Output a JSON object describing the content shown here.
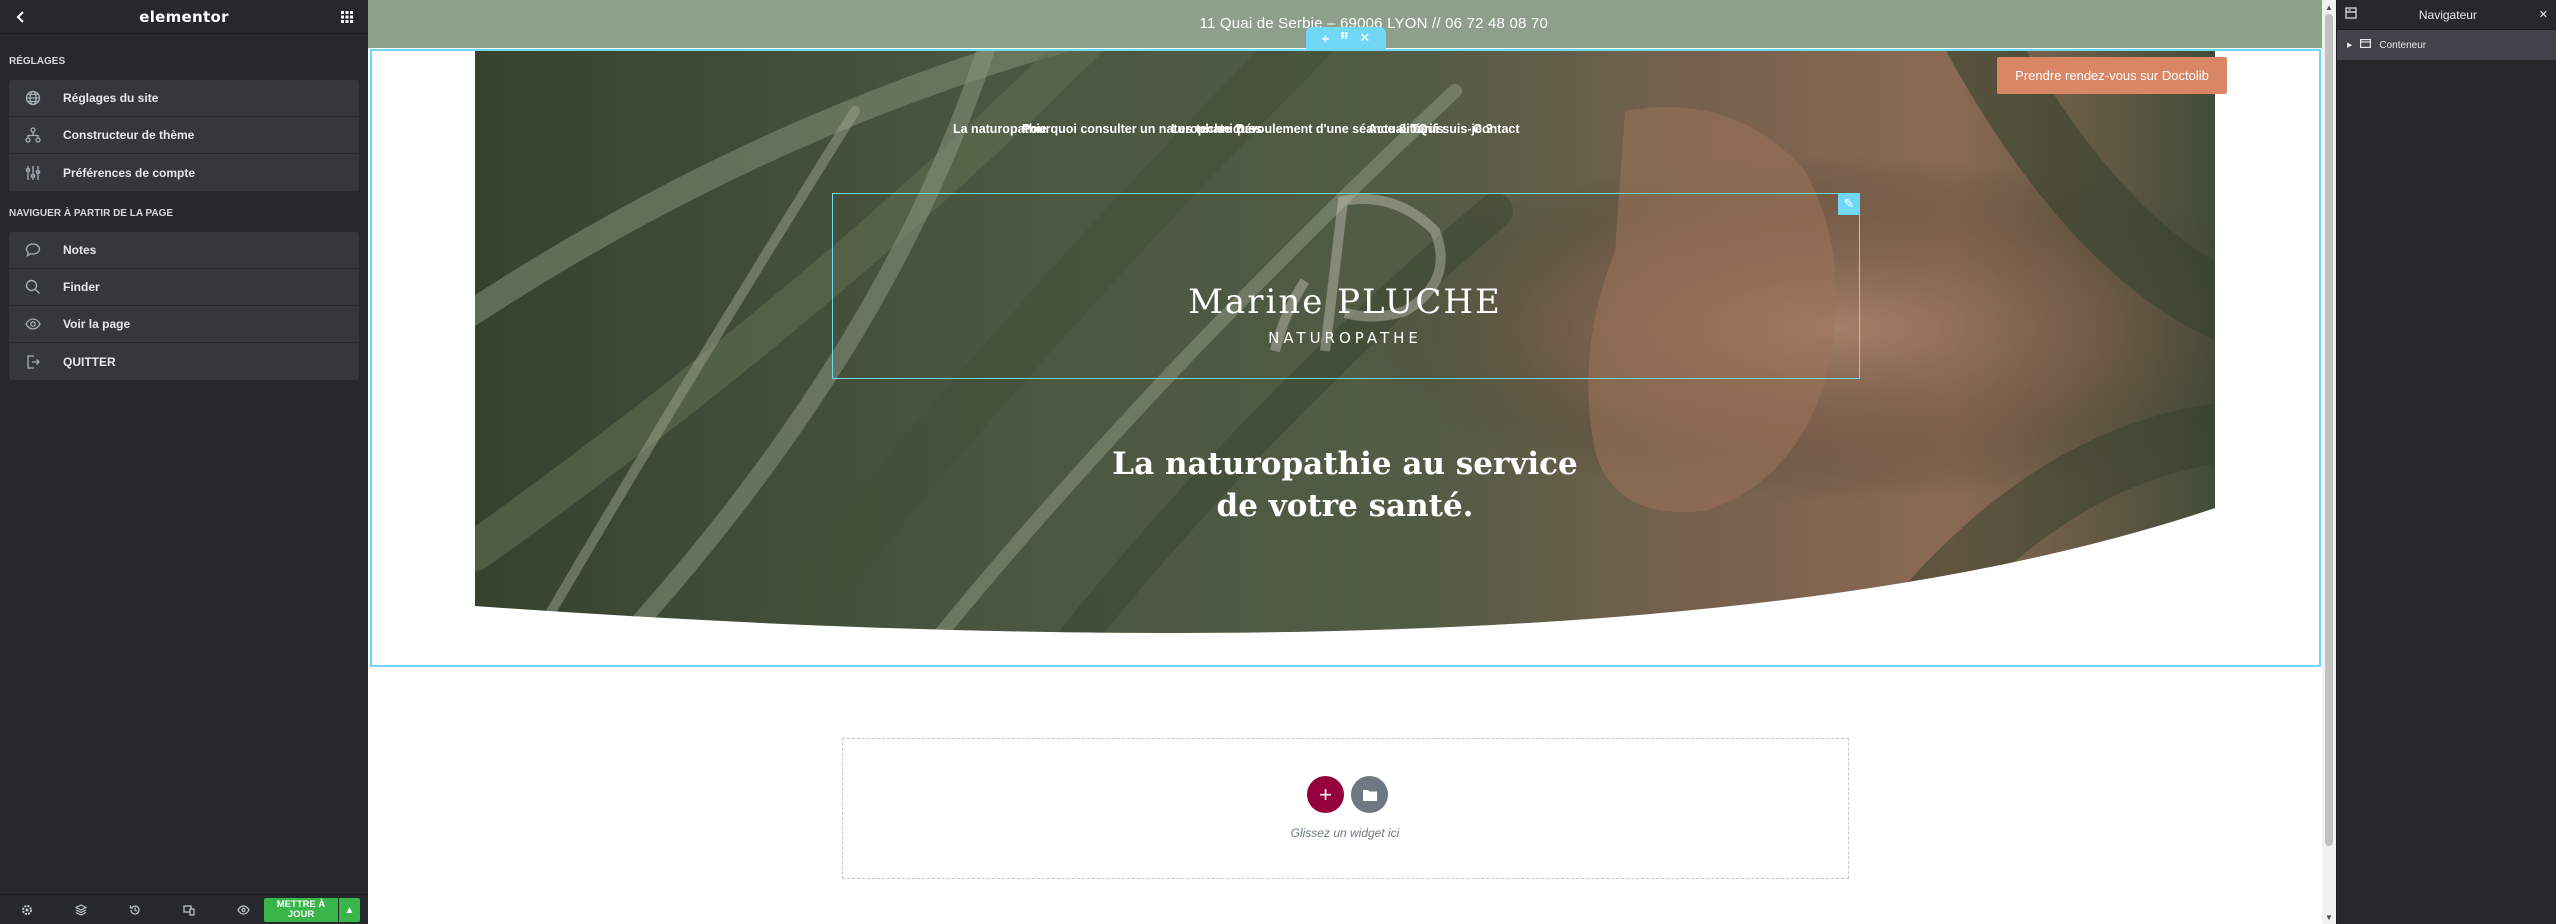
{
  "left_panel": {
    "brand": "elementor",
    "settings_title": "RÉGLAGES",
    "settings_items": [
      {
        "label": "Réglages du site",
        "icon": "globe-icon"
      },
      {
        "label": "Constructeur de thème",
        "icon": "sitemap-icon"
      },
      {
        "label": "Préférences de compte",
        "icon": "sliders-icon"
      }
    ],
    "nav_title": "NAVIGUER À PARTIR DE LA PAGE",
    "nav_items": [
      {
        "label": "Notes",
        "icon": "comment-icon"
      },
      {
        "label": "Finder",
        "icon": "search-icon"
      },
      {
        "label": "Voir la page",
        "icon": "eye-icon"
      },
      {
        "label": "QUITTER",
        "icon": "exit-icon"
      }
    ],
    "footer": {
      "update_label": "METTRE À JOUR",
      "icons": [
        "gear-icon",
        "layers-icon",
        "history-icon",
        "responsive-icon",
        "eye-icon"
      ]
    }
  },
  "canvas": {
    "topbar_text": "11 Quai de Serbie – 69006 LYON // 06 72 48 08 70",
    "cta_label": "Prendre rendez-vous sur Doctolib",
    "menu": [
      "La naturopathie",
      "Pourquoi consulter un naturophate ?",
      "Les techniques",
      "Déroulement d'une séance & Tarifs",
      "Actualités",
      "Qui suis-je ?",
      "Contact"
    ],
    "logo_name": "Marine PLUCHE",
    "logo_subtitle": "NATUROPATHE",
    "tagline_line1": "La naturopathie au service",
    "tagline_line2": "de votre santé.",
    "drop_hint": "Glissez un widget ici"
  },
  "navigator": {
    "title": "Navigateur",
    "tree": [
      {
        "label": "Conteneur",
        "expanded": false
      }
    ]
  },
  "colors": {
    "panel_bg": "#26292c",
    "topbar": "#8ea08b",
    "cta": "#d98664",
    "selection": "#71d7f7",
    "add_button": "#93003c",
    "update_button": "#39b54a"
  }
}
